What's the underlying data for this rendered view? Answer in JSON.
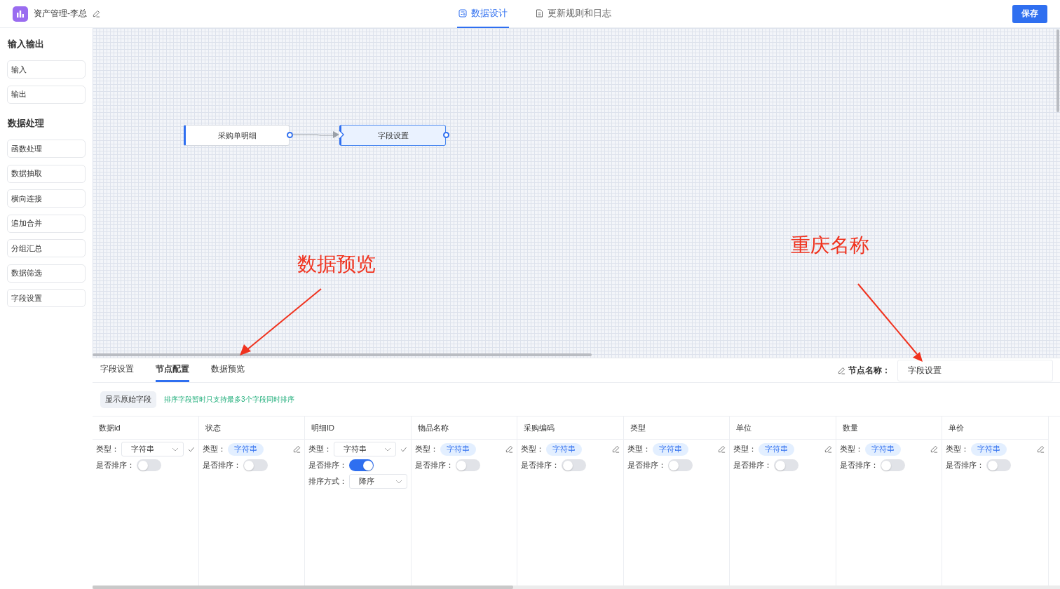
{
  "app": {
    "title": "资产管理-李总"
  },
  "top_tabs": [
    {
      "label": "数据设计",
      "selected": true
    },
    {
      "label": "更新规则和日志",
      "selected": false
    }
  ],
  "save_button": "保存",
  "sidebar": {
    "sections": [
      {
        "title": "输入输出",
        "items": [
          "输入",
          "输出"
        ]
      },
      {
        "title": "数据处理",
        "items": [
          "函数处理",
          "数据抽取",
          "横向连接",
          "追加合并",
          "分组汇总",
          "数据筛选",
          "字段设置"
        ]
      }
    ]
  },
  "canvas": {
    "nodes": [
      {
        "label": "采购单明细",
        "selected": false
      },
      {
        "label": "字段设置",
        "selected": true
      }
    ]
  },
  "annotations": [
    {
      "text": "数据预览"
    },
    {
      "text": "重庆名称"
    }
  ],
  "panel": {
    "tabs": [
      {
        "label": "字段设置",
        "selected": false
      },
      {
        "label": "节点配置",
        "selected": true
      },
      {
        "label": "数据预览",
        "selected": false
      }
    ],
    "node_name_label": "节点名称：",
    "node_name_value": "字段设置",
    "show_original_button": "显示原始字段",
    "hint": "排序字段暂时只支持最多3个字段同时排序",
    "columns": [
      {
        "header": "数据id",
        "type_label": "类型：",
        "kind": "select",
        "type_value": "字符串",
        "sort_label": "是否排序：",
        "sort_on": false
      },
      {
        "header": "状态",
        "type_label": "类型：",
        "kind": "tag",
        "type_value": "字符串",
        "sort_label": "是否排序：",
        "sort_on": false
      },
      {
        "header": "明细ID",
        "type_label": "类型：",
        "kind": "select",
        "type_value": "字符串",
        "sort_label": "是否排序：",
        "sort_on": true,
        "sort_method_label": "排序方式：",
        "sort_method": "降序"
      },
      {
        "header": "物品名称",
        "type_label": "类型：",
        "kind": "tag",
        "type_value": "字符串",
        "sort_label": "是否排序：",
        "sort_on": false
      },
      {
        "header": "采购编码",
        "type_label": "类型：",
        "kind": "tag",
        "type_value": "字符串",
        "sort_label": "是否排序：",
        "sort_on": false
      },
      {
        "header": "类型",
        "type_label": "类型：",
        "kind": "tag",
        "type_value": "字符串",
        "sort_label": "是否排序：",
        "sort_on": false
      },
      {
        "header": "单位",
        "type_label": "类型：",
        "kind": "tag",
        "type_value": "字符串",
        "sort_label": "是否排序：",
        "sort_on": false
      },
      {
        "header": "数量",
        "type_label": "类型：",
        "kind": "tag",
        "type_value": "字符串",
        "sort_label": "是否排序：",
        "sort_on": false
      },
      {
        "header": "单价",
        "type_label": "类型：",
        "kind": "tag",
        "type_value": "字符串",
        "sort_label": "是否排序：",
        "sort_on": false
      }
    ]
  }
}
